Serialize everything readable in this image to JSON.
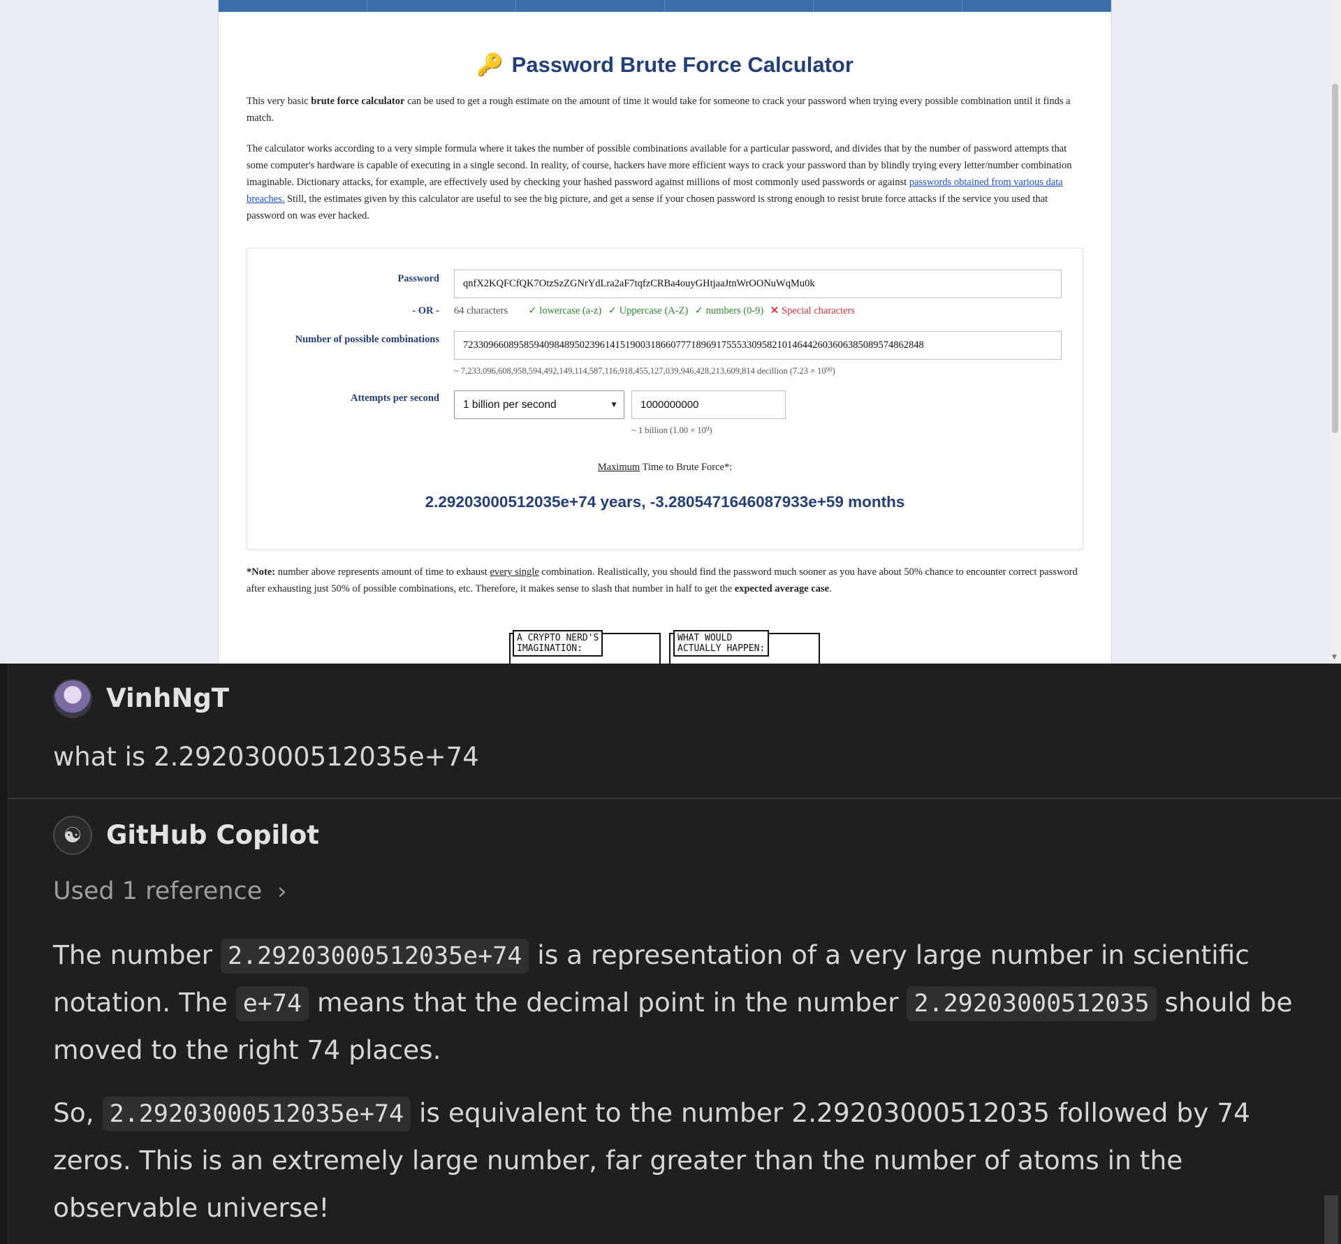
{
  "calculator": {
    "title": "Password Brute Force Calculator",
    "key_icon": "🔑",
    "intro_p1_a": "This very basic ",
    "intro_p1_b": "brute force calculator",
    "intro_p1_c": " can be used to get a rough estimate on the amount of time it would take for someone to crack your password when trying every possible combination until it finds a match.",
    "intro_p2_a": "The calculator works according to a very simple formula where it takes the number of possible combinations available for a particular password, and divides that by the number of password attempts that some computer's hardware is capable of executing in a single second. In reality, of course, hackers have more efficient ways to crack your password than by blindly trying every letter/number combination imaginable. Dictionary attacks, for example, are effectively used by checking your hashed password against millions of most commonly used passwords or against ",
    "intro_p2_link": "passwords obtained from various data breaches.",
    "intro_p2_b": " Still, the estimates given by this calculator are useful to see the big picture, and get a sense if your chosen password is strong enough to resist brute force attacks if the service you used that password on was ever hacked.",
    "password_label": "Password",
    "password_value": "qnfX2KQFCfQK7OtzSzZGNrYdLra2aF7tqfzCRBa4ouyGHtjaaJtnWrOONuWqMu0k",
    "or_label": "- OR -",
    "char_count": "64 characters",
    "check_lower": "✓ lowercase (a-z)",
    "check_upper": "✓ Uppercase (A-Z)",
    "check_numbers": "✓ numbers (0-9)",
    "special_mark": "✕",
    "special_label": "Special characters",
    "combinations_label": "Number of possible combinations",
    "combinations_value": "7233096608958594098489502396141519003186607771896917555330958210146442603606385089574862848",
    "combinations_note": "~ 7,233,096,608,958,594,492,149,114,587,116,918,455,127,039,946,428,213,609,814 decillion (7.23 × 10",
    "combinations_exp": "90",
    "combinations_close": ")",
    "attempts_label": "Attempts per second",
    "attempts_select": "1 billion per second",
    "attempts_value": "1000000000",
    "attempts_note": "~ 1 billion (1.00 × 10",
    "attempts_exp": "9",
    "attempts_close": ")",
    "max_label_u": "Maximum",
    "max_label_rest": " Time to Brute Force*:",
    "result": "2.29203000512035e+74 years, -3.2805471646087933e+59 months",
    "note_a": "*Note:",
    "note_b": " number above represents amount of time to exhaust ",
    "note_u": "every single",
    "note_c": " combination. Realistically, you should find the password much sooner as you have about 50% chance to encounter correct password after exhausting just 50% of possible combinations, etc. Therefore, it makes sense to slash that number in half to get the ",
    "note_d": "expected average case",
    "note_e": ".",
    "comic_label_1": "A CRYPTO NERD'S\nIMAGINATION:",
    "comic_label_2": "WHAT WOULD\nACTUALLY HAPPEN:"
  },
  "chat": {
    "user_name": "VinhNgT",
    "user_message": "what is 2.29203000512035e+74",
    "assistant_name": "GitHub Copilot",
    "reference": "Used 1 reference",
    "p1_a": "The number ",
    "p1_code1": "2.29203000512035e+74",
    "p1_b": " is a representation of a very large number in scientific notation. The ",
    "p1_code2": "e+74",
    "p1_c": " means that the decimal point in the number ",
    "p1_code3": "2.29203000512035",
    "p1_d": " should be moved to the right 74 places.",
    "p2_a": "So, ",
    "p2_code": "2.29203000512035e+74",
    "p2_b": " is equivalent to the number 2.29203000512035 followed by 74 zeros. This is an extremely large number, far greater than the number of atoms in the observable universe!"
  },
  "icons": {
    "copilot": "copilot-icon",
    "chevron": "chevron-right-icon"
  }
}
